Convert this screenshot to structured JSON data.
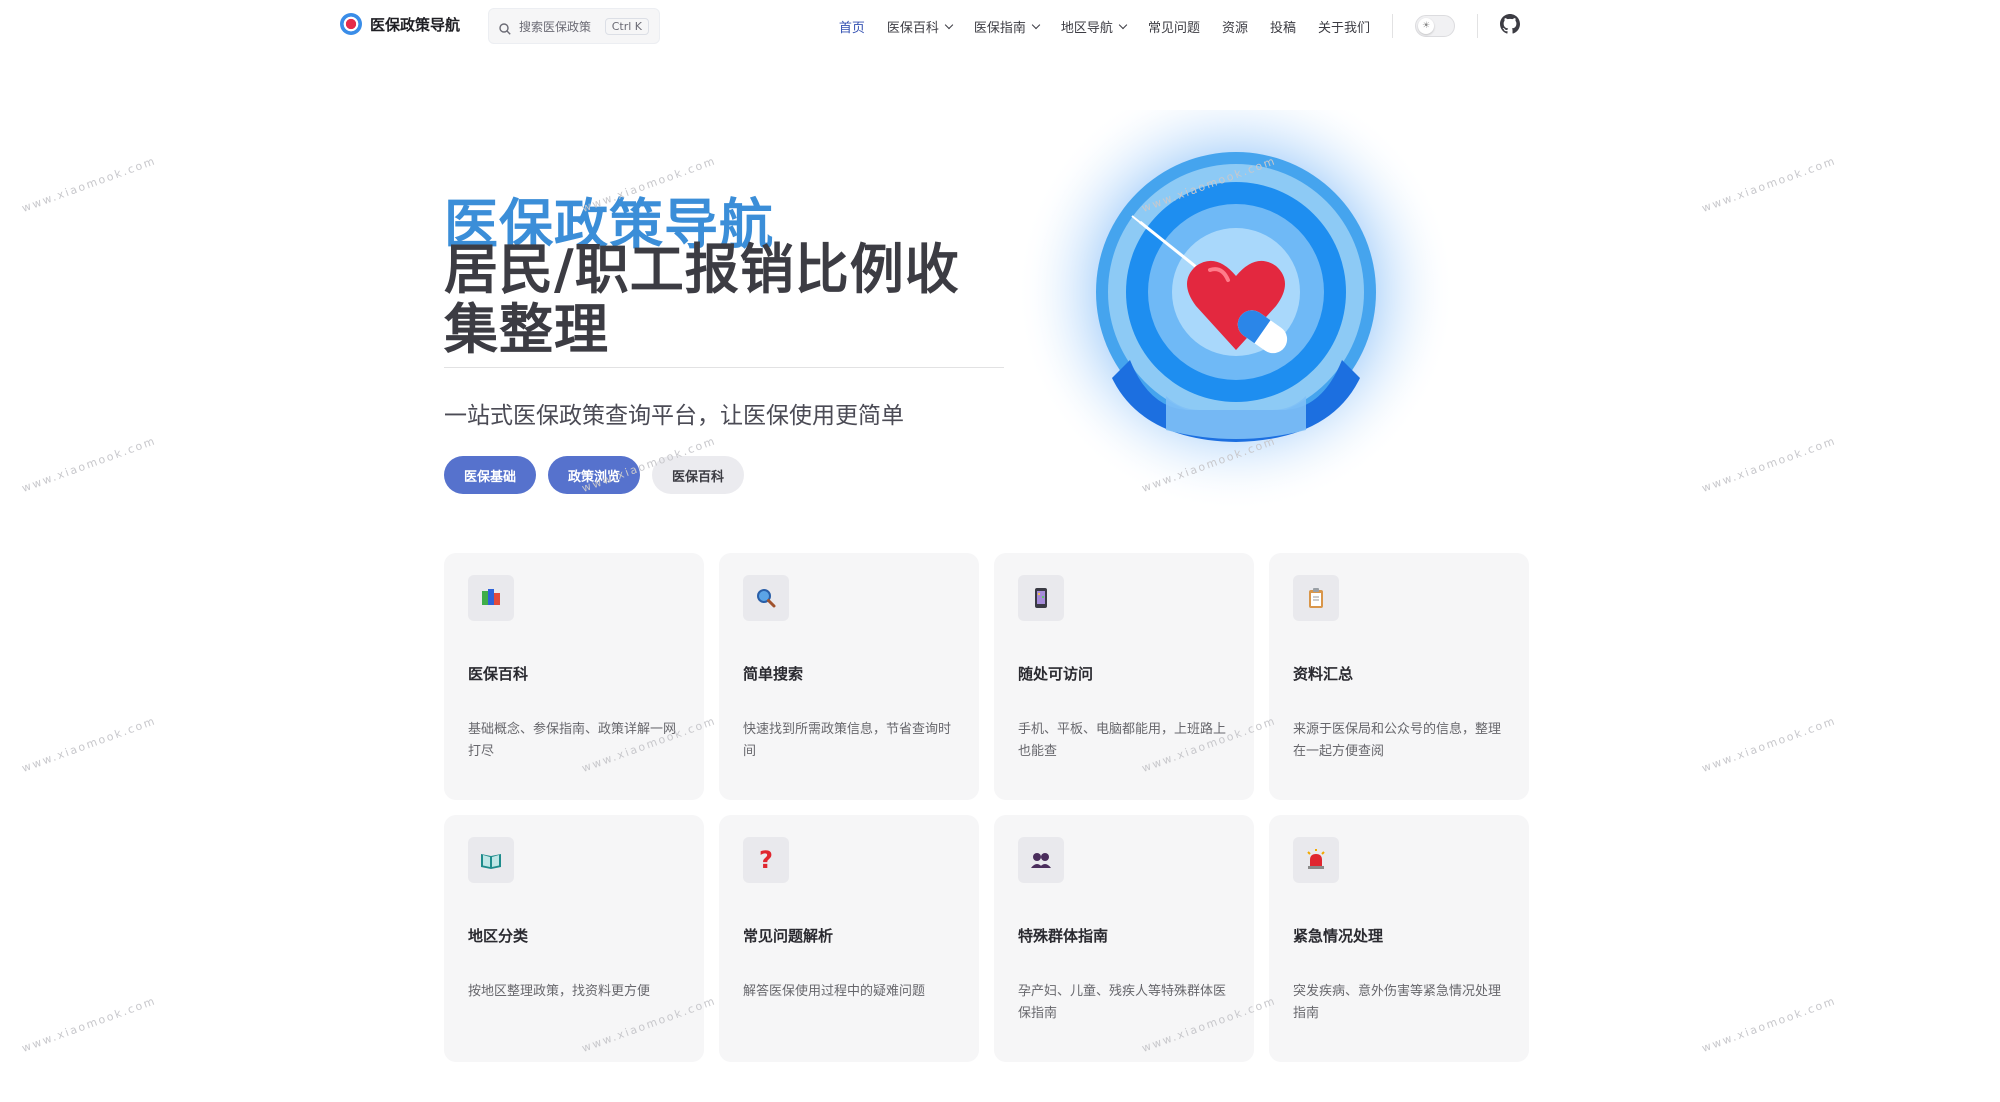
{
  "nav": {
    "brand": "医保政策导航",
    "search_placeholder": "搜索医保政策",
    "search_shortcut": "Ctrl K",
    "items": [
      {
        "label": "首页",
        "active": true,
        "dropdown": false
      },
      {
        "label": "医保百科",
        "active": false,
        "dropdown": true
      },
      {
        "label": "医保指南",
        "active": false,
        "dropdown": true
      },
      {
        "label": "地区导航",
        "active": false,
        "dropdown": true
      },
      {
        "label": "常见问题",
        "active": false,
        "dropdown": false
      },
      {
        "label": "资源",
        "active": false,
        "dropdown": false
      },
      {
        "label": "投稿",
        "active": false,
        "dropdown": false
      },
      {
        "label": "关于我们",
        "active": false,
        "dropdown": false
      }
    ]
  },
  "hero": {
    "name": "医保政策导航",
    "text": "居民/职工报销比例收集整理",
    "tagline": "一站式医保政策查询平台，让医保使用更简单",
    "actions": [
      {
        "label": "医保基础",
        "theme": "brand"
      },
      {
        "label": "政策浏览",
        "theme": "brand"
      },
      {
        "label": "医保百科",
        "theme": "alt"
      }
    ]
  },
  "features": [
    {
      "icon": "books-icon",
      "title": "医保百科",
      "desc": "基础概念、参保指南、政策详解一网打尽"
    },
    {
      "icon": "magnifier-icon",
      "title": "简单搜索",
      "desc": "快速找到所需政策信息，节省查询时间"
    },
    {
      "icon": "phone-icon",
      "title": "随处可访问",
      "desc": "手机、平板、电脑都能用，上班路上也能查"
    },
    {
      "icon": "clipboard-icon",
      "title": "资料汇总",
      "desc": "来源于医保局和公众号的信息，整理在一起方便查阅"
    },
    {
      "icon": "open-book-icon",
      "title": "地区分类",
      "desc": "按地区整理政策，找资料更方便"
    },
    {
      "icon": "question-mark-icon",
      "title": "常见问题解析",
      "desc": "解答医保使用过程中的疑难问题"
    },
    {
      "icon": "people-icon",
      "title": "特殊群体指南",
      "desc": "孕产妇、儿童、残疾人等特殊群体医保指南"
    },
    {
      "icon": "alarm-light-icon",
      "title": "紧急情况处理",
      "desc": "突发疾病、意外伤害等紧急情况处理指南"
    }
  ],
  "watermark": "www.xiaomook.com",
  "colors": {
    "brand": "#3451b2",
    "hero_name": "#3b8ed8",
    "button": "#5672cd",
    "card_bg": "#f6f6f7"
  }
}
